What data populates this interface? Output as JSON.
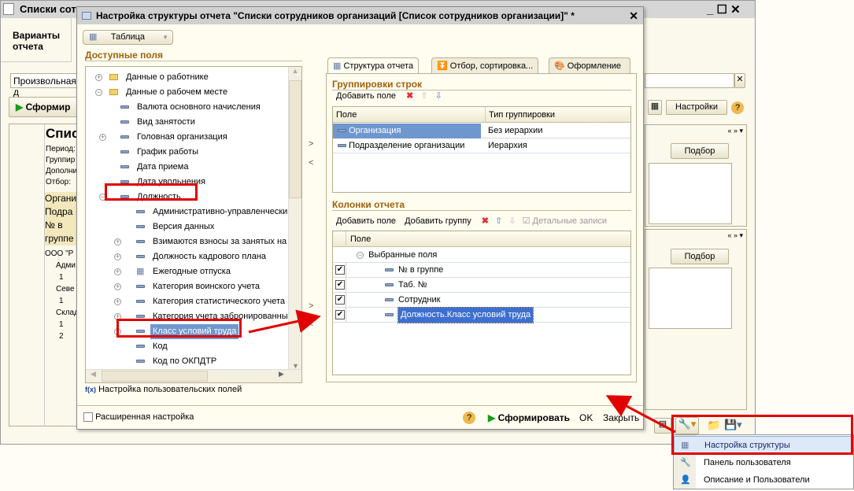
{
  "bg_window": {
    "title": "Списки сотр",
    "variants": "Варианты отчета",
    "input_value": "Произвольная д",
    "generate": "Сформир",
    "settings": "Настройки",
    "pick": "Подбор",
    "pick2": "Подбор",
    "report_title": "Спис",
    "report_lines": [
      "Период:",
      "Группир",
      "Дополни",
      "Отбор: "
    ],
    "headers": [
      "Органи",
      "Подра",
      "№ в группе"
    ],
    "rows": [
      "ООО \"Р",
      "Адми",
      "1",
      "Севе",
      "1",
      "Склад",
      "1",
      "2"
    ]
  },
  "dialog": {
    "title": "Настройка структуры отчета \"Списки сотрудников организаций [Список сотрудников организации]\" *",
    "view_select": "Таблица",
    "available_label": "Доступные поля",
    "tree": [
      {
        "label": "Данные о работнике",
        "level": 0,
        "expander": "+",
        "icon": "folder"
      },
      {
        "label": "Данные о рабочем месте",
        "level": 0,
        "expander": "-",
        "icon": "folder"
      },
      {
        "label": "Валюта основного начисления",
        "level": 1,
        "expander": "",
        "icon": "field"
      },
      {
        "label": "Вид занятости",
        "level": 1,
        "expander": "",
        "icon": "field"
      },
      {
        "label": "Головная организация",
        "level": 1,
        "expander": "+",
        "icon": "field"
      },
      {
        "label": "График работы",
        "level": 1,
        "expander": "",
        "icon": "field"
      },
      {
        "label": "Дата приема",
        "level": 1,
        "expander": "",
        "icon": "field"
      },
      {
        "label": "Дата увольнения",
        "level": 1,
        "expander": "",
        "icon": "field"
      },
      {
        "label": "Должность",
        "level": 1,
        "expander": "-",
        "icon": "field"
      },
      {
        "label": "Административно-управленческий",
        "level": 2,
        "expander": "",
        "icon": "field"
      },
      {
        "label": "Версия данных",
        "level": 2,
        "expander": "",
        "icon": "field"
      },
      {
        "label": "Взимаются взносы за занятых на",
        "level": 2,
        "expander": "+",
        "icon": "field"
      },
      {
        "label": "Должность кадрового плана",
        "level": 2,
        "expander": "+",
        "icon": "field"
      },
      {
        "label": "Ежегодные отпуска",
        "level": 2,
        "expander": "+",
        "icon": "table"
      },
      {
        "label": "Категория воинского учета",
        "level": 2,
        "expander": "+",
        "icon": "field"
      },
      {
        "label": "Категория статистического учета",
        "level": 2,
        "expander": "+",
        "icon": "field"
      },
      {
        "label": "Категория учета забронированных",
        "level": 2,
        "expander": "+",
        "icon": "field"
      },
      {
        "label": "Класс условий труда",
        "level": 2,
        "expander": "+",
        "icon": "field",
        "selected": true
      },
      {
        "label": "Код",
        "level": 2,
        "expander": "",
        "icon": "field"
      },
      {
        "label": "Код по ОКПДТР",
        "level": 2,
        "expander": "",
        "icon": "field"
      }
    ],
    "custom_fields": "Настройка пользовательских полей",
    "tabs": [
      "Структура отчета",
      "Отбор, сортировка...",
      "Оформление"
    ],
    "groupings": {
      "label": "Группировки строк",
      "add_field": "Добавить поле",
      "columns": [
        "Поле",
        "Тип группировки"
      ],
      "rows": [
        {
          "field": "Организация",
          "type": "Без иерархии",
          "selected": true
        },
        {
          "field": "Подразделение организации",
          "type": "Иерархия"
        }
      ]
    },
    "report_columns": {
      "label": "Колонки отчета",
      "add_field": "Добавить поле",
      "add_group": "Добавить группу",
      "detail_records": "Детальные записи",
      "column": "Поле",
      "group": "Выбранные поля",
      "rows": [
        {
          "label": "№ в группе",
          "checked": true
        },
        {
          "label": "Таб. №",
          "checked": true
        },
        {
          "label": "Сотрудник",
          "checked": true
        },
        {
          "label": "Должность.Класс условий труда",
          "checked": true,
          "selected": true
        }
      ]
    },
    "advanced": "Расширенная настройка",
    "generate": "Сформировать",
    "ok": "OK",
    "close": "Закрыть"
  },
  "menu": {
    "items": [
      "Настройка структуры",
      "Панель пользователя",
      "Описание и Пользователи"
    ]
  },
  "colors": {
    "accent": "#a0620a",
    "selection": "#6f97cf",
    "highlight": "#e00000"
  }
}
